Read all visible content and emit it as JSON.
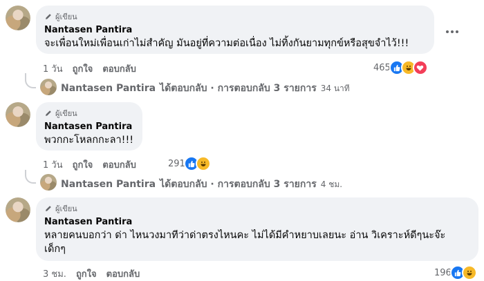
{
  "comments": [
    {
      "badge": "ผู้เขียน",
      "name": "Nantasen Pantira",
      "text": "จะเพื่อนใหม่เพื่อนเก่าไม่สำคัญ มันอยู่ที่ความต่อเนื่อง ไม่ทิ้งกันยามทุกข์หรือสุขจำไว้!!!",
      "time": "1 วัน",
      "like": "ถูกใจ",
      "reply": "ตอบกลับ",
      "reaction_count": "465",
      "reactions": [
        "like",
        "haha",
        "love"
      ],
      "replies_summary": {
        "name": "Nantasen Pantira",
        "label": "ได้ตอบกลับ · การตอบกลับ 3 รายการ",
        "time": "34 นาที"
      }
    },
    {
      "badge": "ผู้เขียน",
      "name": "Nantasen Pantira",
      "text": "พวกกะโหลกกะลา!!!",
      "time": "1 วัน",
      "like": "ถูกใจ",
      "reply": "ตอบกลับ",
      "reaction_count": "291",
      "reactions": [
        "like",
        "haha"
      ],
      "replies_summary": {
        "name": "Nantasen Pantira",
        "label": "ได้ตอบกลับ · การตอบกลับ 3 รายการ",
        "time": "4 ชม."
      }
    },
    {
      "badge": "ผู้เขียน",
      "name": "Nantasen Pantira",
      "text": "หลายคนบอกว่า ด่า ไหนวงมาทีว่าด่าตรงไหนคะ ไม่ได้มีคำหยาบเลยนะ อ่าน วิเคราะห์ดีๆนะจ๊ะเด็กๆ",
      "time": "3 ชม.",
      "like": "ถูกใจ",
      "reply": "ตอบกลับ",
      "reaction_count": "196",
      "reactions": [
        "like",
        "haha"
      ]
    }
  ],
  "colors": {
    "like": "#1877f2",
    "haha": "#f7b928",
    "love": "#f33e58",
    "bubble": "#f0f2f5",
    "meta": "#65676b"
  },
  "icons": {
    "author_badge": "pen-icon",
    "more": "more-dots-icon"
  }
}
